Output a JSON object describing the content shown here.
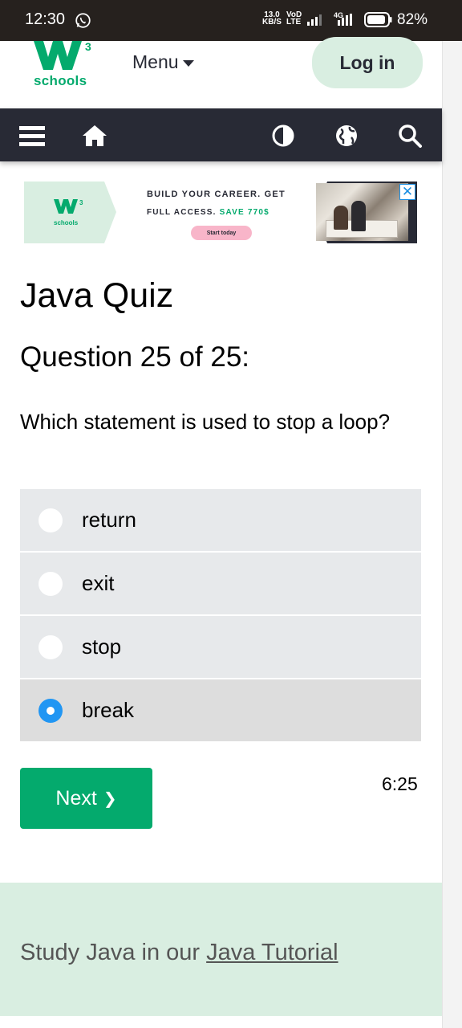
{
  "status_bar": {
    "time": "12:30",
    "speed_value": "13.0",
    "speed_unit": "KB/S",
    "volte_top": "VoD",
    "volte_bottom": "LTE",
    "network": "4G",
    "battery_percent": "82%"
  },
  "header": {
    "logo_text": "schools",
    "logo_superscript": "3",
    "menu_label": "Menu",
    "login_label": "Log in"
  },
  "navbar": {
    "icons": [
      "menu-icon",
      "home-icon",
      "contrast-icon",
      "globe-icon",
      "search-icon"
    ]
  },
  "ad": {
    "logo_text": "schools",
    "line1": "BUILD YOUR CAREER. GET",
    "line2_prefix": "FULL ACCESS.",
    "line2_accent": "SAVE 770$",
    "cta": "Start today",
    "close": "✕"
  },
  "quiz": {
    "title": "Java Quiz",
    "question_count": "Question 25 of 25:",
    "question": "Which statement is used to stop a loop?",
    "options": [
      {
        "label": "return",
        "selected": false
      },
      {
        "label": "exit",
        "selected": false
      },
      {
        "label": "stop",
        "selected": false
      },
      {
        "label": "break",
        "selected": true
      }
    ],
    "next_label": "Next",
    "next_arrow": "❯",
    "timer": "6:25"
  },
  "footer": {
    "text_prefix": "Study Java in our ",
    "link_text": "Java Tutorial"
  },
  "colors": {
    "brand_green": "#04aa6d",
    "navbar_bg": "#282a35",
    "light_green": "#d9eee1",
    "radio_selected": "#2196f3"
  }
}
